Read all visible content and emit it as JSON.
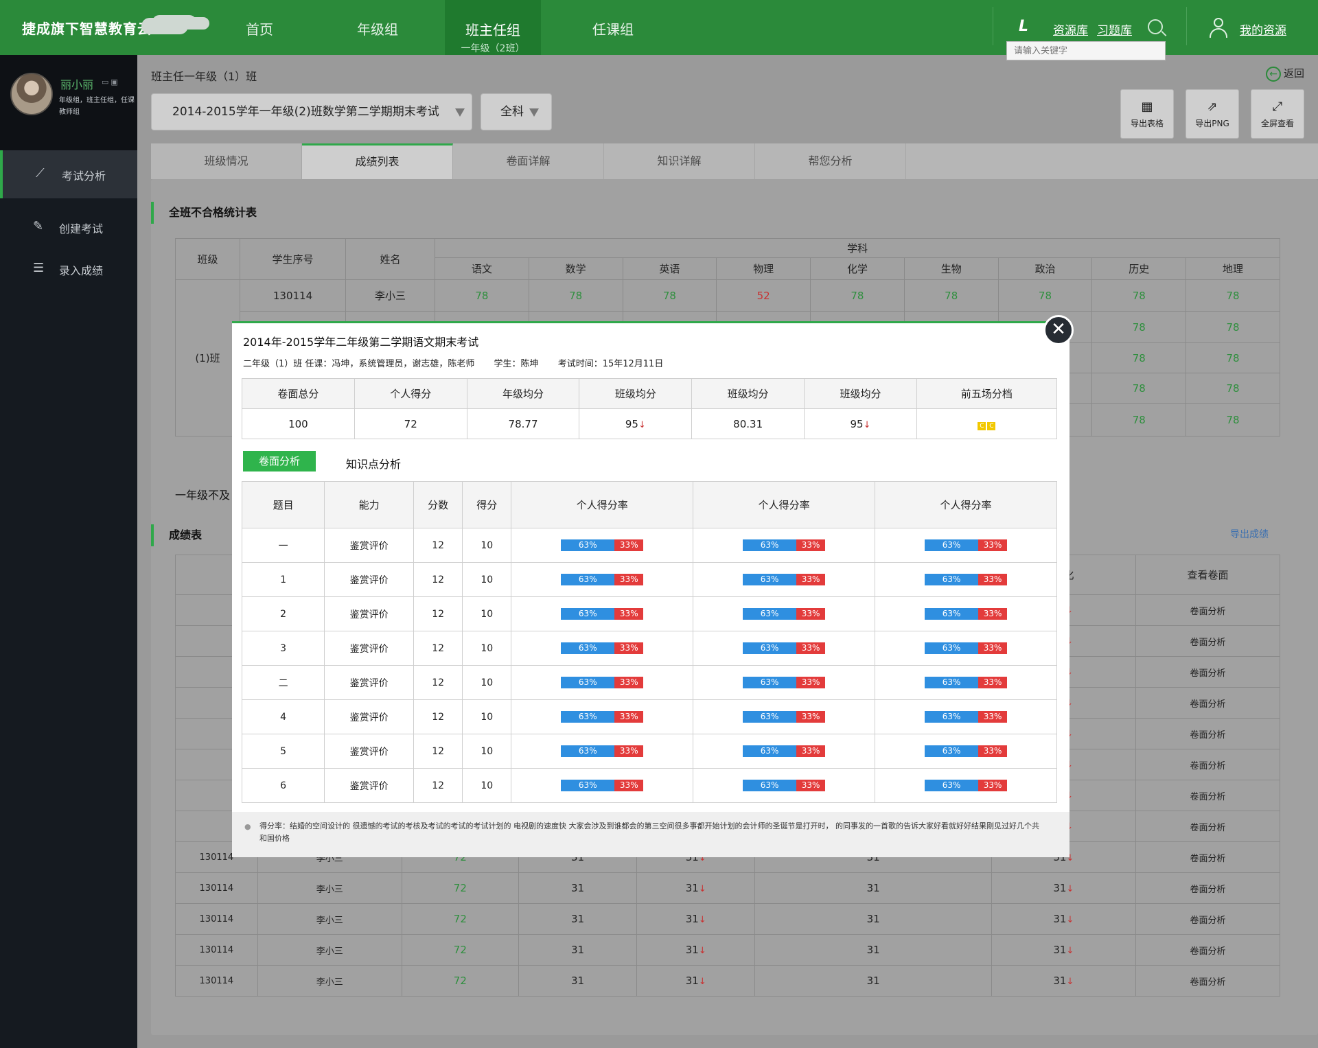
{
  "header": {
    "brand": "捷成旗下智慧教育云",
    "nav": [
      {
        "label": "首页"
      },
      {
        "label": "年级组"
      },
      {
        "label": "班主任组",
        "sub": "一年级（2班）"
      },
      {
        "label": "任课组"
      }
    ],
    "resource_lib": "资源库",
    "exercise_lib": "习题库",
    "search_placeholder": "请输入关键字",
    "my_resources": "我的资源",
    "lib_icon_glyph": "L"
  },
  "sidebar": {
    "user_name": "丽小丽",
    "user_role": "年级组，班主任组，任课教师组",
    "items": [
      {
        "label": "考试分析",
        "icon": "chart-icon"
      },
      {
        "label": "创建考试",
        "icon": "edit-icon"
      },
      {
        "label": "录入成绩",
        "icon": "list-icon"
      }
    ]
  },
  "main": {
    "breadcrumb": "班主任一年级（1）班",
    "back_label": "返回",
    "exam_select": "2014-2015学年一年级(2)班数学第二学期期末考试",
    "subject_select": "全科",
    "tools": [
      {
        "label": "导出表格",
        "icon": "table-icon"
      },
      {
        "label": "导出PNG",
        "icon": "export-icon"
      },
      {
        "label": "全屏查看",
        "icon": "fullscreen-icon"
      }
    ],
    "tabs": [
      "班级情况",
      "成绩列表",
      "卷面详解",
      "知识详解",
      "帮您分析"
    ],
    "fail_panel": {
      "title": "全班不合格统计表",
      "col_class": "班级",
      "col_id": "学生序号",
      "col_name": "姓名",
      "subject_group": "学科",
      "subjects": [
        "语文",
        "数学",
        "英语",
        "物理",
        "化学",
        "生物",
        "政治",
        "历史",
        "地理"
      ],
      "class_name": "(1)班",
      "rows": [
        {
          "id": "130114",
          "name": "李小三",
          "scores": [
            "78",
            "78",
            "78",
            "52",
            "78",
            "78",
            "78",
            "78",
            "78"
          ]
        },
        {
          "id": "130114",
          "name": "李小三",
          "scores": [
            "78",
            "78",
            "78",
            "78",
            "78",
            "78",
            "78",
            "78",
            "78"
          ]
        },
        {
          "id": "",
          "name": "",
          "scores": [
            "",
            "",
            "",
            "",
            "",
            "",
            "",
            "78",
            "78"
          ]
        },
        {
          "id": "",
          "name": "",
          "scores": [
            "",
            "",
            "",
            "",
            "",
            "",
            "",
            "78",
            "78"
          ]
        },
        {
          "id": "",
          "name": "",
          "scores": [
            "",
            "",
            "",
            "",
            "",
            "",
            "",
            "78",
            "78"
          ]
        }
      ],
      "note_fragment": "一年级不及"
    },
    "score_panel": {
      "title": "成绩表",
      "export": "导出成绩",
      "col_change": "变化",
      "col_view": "查看卷面",
      "view_label": "卷面分析",
      "partial_rows": [
        {
          "change": "31"
        },
        {
          "change": "31"
        },
        {
          "change": "31"
        },
        {
          "change": "31"
        },
        {
          "change": "31"
        },
        {
          "change": "31"
        },
        {
          "change": "31"
        },
        {
          "change": "31"
        }
      ],
      "rows": [
        {
          "id": "130114",
          "name": "李小三",
          "score": "72",
          "c1": "31",
          "c2": "31",
          "c3": "31",
          "c4": "31"
        },
        {
          "id": "130114",
          "name": "李小三",
          "score": "72",
          "c1": "31",
          "c2": "31",
          "c3": "31",
          "c4": "31"
        },
        {
          "id": "130114",
          "name": "李小三",
          "score": "72",
          "c1": "31",
          "c2": "31",
          "c3": "31",
          "c4": "31"
        },
        {
          "id": "130114",
          "name": "李小三",
          "score": "72",
          "c1": "31",
          "c2": "31",
          "c3": "31",
          "c4": "31"
        },
        {
          "id": "130114",
          "name": "李小三",
          "score": "72",
          "c1": "31",
          "c2": "31",
          "c3": "31",
          "c4": "31"
        }
      ]
    }
  },
  "modal": {
    "title": "2014年-2015学年二年级第二学期语文期末考试",
    "class_info": "二年级（1）班   任课：冯坤，系统管理员，谢志雄，陈老师",
    "student": "学生：陈坤",
    "exam_time": "考试时间：15年12月11日",
    "summary_headers": [
      "卷面总分",
      "个人得分",
      "年级均分",
      "班级均分",
      "班级均分",
      "班级均分",
      "前五场分档"
    ],
    "summary_values": [
      "100",
      "72",
      "78.77",
      "95",
      "80.31",
      "95",
      ""
    ],
    "summary_down": [
      false,
      false,
      false,
      true,
      false,
      true,
      false
    ],
    "grade_badges": [
      "C",
      "C"
    ],
    "tab_active": "卷面分析",
    "tab_other": "知识点分析",
    "detail_headers": [
      "题目",
      "能力",
      "分数",
      "得分",
      "个人得分率",
      "个人得分率",
      "个人得分率"
    ],
    "rows": [
      {
        "q": "一",
        "ability": "鉴赏评价",
        "points": "12",
        "got": "10"
      },
      {
        "q": "1",
        "ability": "鉴赏评价",
        "points": "12",
        "got": "10"
      },
      {
        "q": "2",
        "ability": "鉴赏评价",
        "points": "12",
        "got": "10"
      },
      {
        "q": "3",
        "ability": "鉴赏评价",
        "points": "12",
        "got": "10"
      },
      {
        "q": "二",
        "ability": "鉴赏评价",
        "points": "12",
        "got": "10"
      },
      {
        "q": "4",
        "ability": "鉴赏评价",
        "points": "12",
        "got": "10"
      },
      {
        "q": "5",
        "ability": "鉴赏评价",
        "points": "12",
        "got": "10"
      },
      {
        "q": "6",
        "ability": "鉴赏评价",
        "points": "12",
        "got": "10"
      }
    ],
    "rate_good": "63%",
    "rate_bad": "33%",
    "footnote": "得分率：结婚的空间设计的    很遗憾的考试的考核及考试的考试的考试计划的    电视剧的速度快    大家会涉及到谁都会的第三空间很多事都开始计划的会计师的圣诞节是打开时，   的同事发的一首歌的告诉大家好看就好好结果刚见过好几个共和国价格",
    "close_glyph": "✕"
  },
  "colors": {
    "brand_green": "#2b8a3a",
    "accent_green": "#2fb44c",
    "bar_blue": "#2f8fe0",
    "bar_red": "#e33b3b"
  }
}
